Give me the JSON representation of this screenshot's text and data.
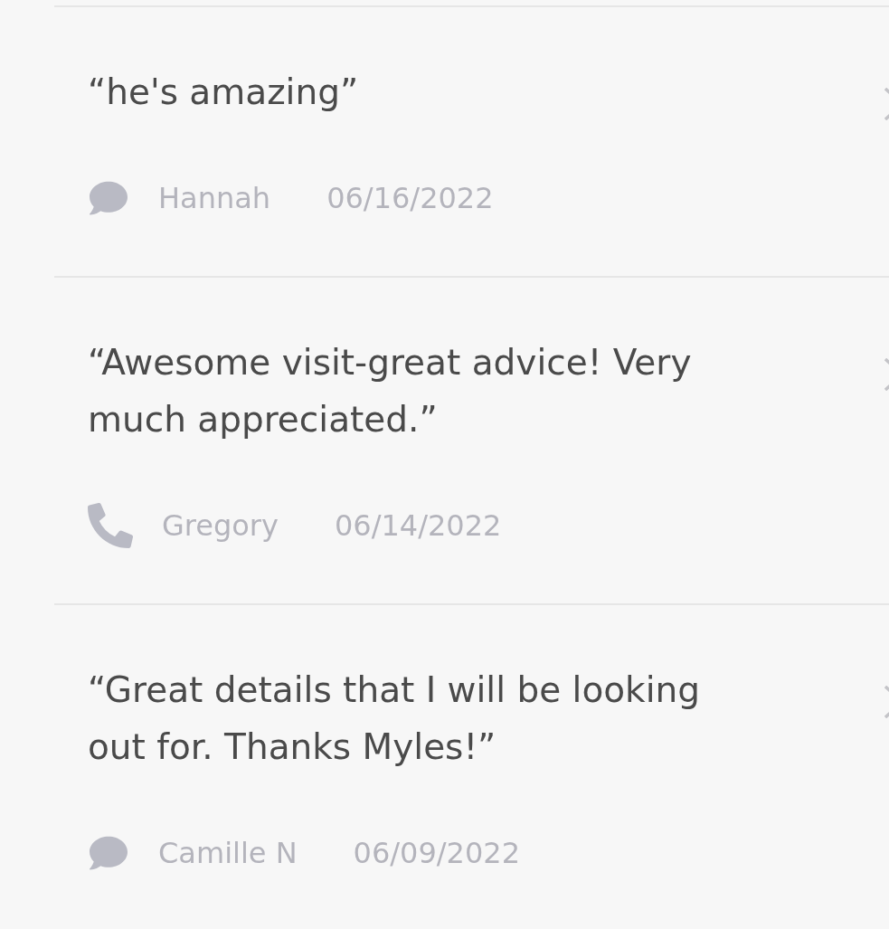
{
  "reviews": [
    {
      "quote": "“he's amazing”",
      "kind": "comment",
      "author": "Hannah",
      "date": "06/16/2022"
    },
    {
      "quote": "“Awesome visit-great advice! Very much appreciated.”",
      "kind": "phone",
      "author": "Gregory",
      "date": "06/14/2022"
    },
    {
      "quote": "“Great details that I will be looking out for. Thanks Myles!”",
      "kind": "comment",
      "author": "Camille N",
      "date": "06/09/2022"
    }
  ]
}
